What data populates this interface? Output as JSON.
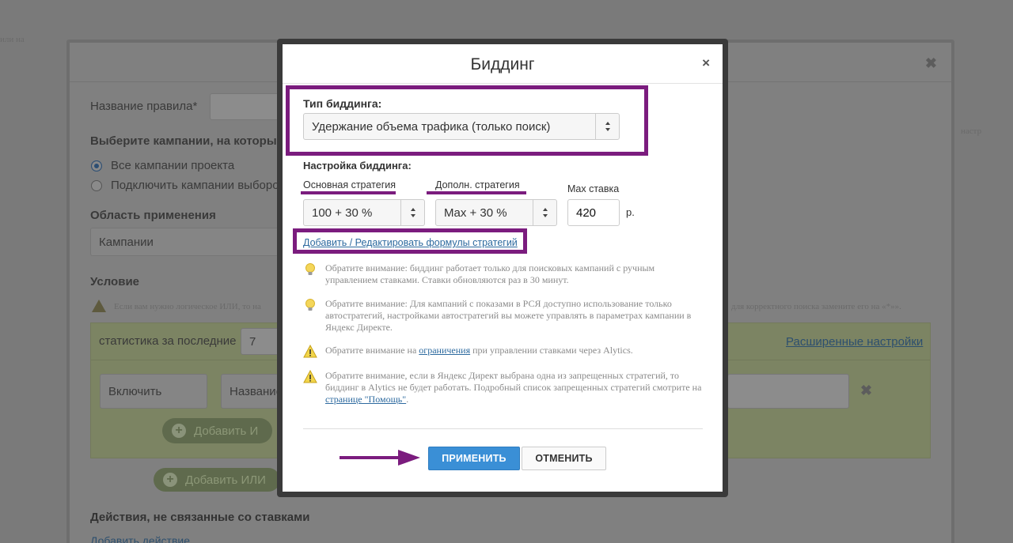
{
  "background": {
    "name_label": "Название правила*",
    "campaigns_heading": "Выберите кампании, на которые",
    "radio_all": "Все кампании проекта",
    "radio_select": "Подключить кампании выборочно",
    "scope_heading": "Область применения",
    "scope_value": "Кампании",
    "condition_heading": "Условие",
    "condition_hint_left": "Если вам нужно логическое ИЛИ, то на",
    "condition_hint_right": "для корректного поиска замените его на «*»».",
    "stats_label": "статистика за последние",
    "stats_value": "7",
    "advanced_link": "Расширенные настройки",
    "include_value": "Включить",
    "name_value": "Название",
    "add_and": "Добавить И",
    "add_or": "Добавить ИЛИ",
    "actions_heading": "Действия, не связанные со ставками",
    "add_action": "Добавить действие",
    "top_left_frag": "или на",
    "right_frag": "настр"
  },
  "dialog": {
    "title": "Биддинг",
    "close_label": "×",
    "bidding_type_label": "Тип биддинга:",
    "bidding_type_value": "Удержание объема трафика (только поиск)",
    "settings_label": "Настройка биддинга:",
    "main_strategy_label": "Основная стратегия",
    "main_strategy_value": "100 + 30 %",
    "extra_strategy_label": "Дополн. стратегия",
    "extra_strategy_value": "Max + 30 %",
    "max_bid_label": "Max ставка",
    "max_bid_value": "420",
    "currency": "р.",
    "formulas_link": "Добавить / Редактировать формулы стратегий",
    "note1": "Обратите внимание: биддинг работает только для поисковых кампаний с ручным управлением ставками. Ставки обновляются раз в 30 минут.",
    "note2": "Обратите внимание: Для кампаний с показами в РСЯ доступно использование только автостратегий, настройками автостратегий вы можете управлять в параметрах кампании в Яндекс Директе.",
    "note3_before": "Обратите внимание на ",
    "note3_link": "ограничения",
    "note3_after": " при управлении ставками через Alytics.",
    "note4_before": "Обратите внимание, если в Яндекс Директ выбрана одна из запрещенных стратегий, то биддинг в Alytics не будет работать. Подробный список запрещенных стратегий смотрите на ",
    "note4_link": "странице \"Помощь\"",
    "note4_after": ".",
    "apply_label": "ПРИМЕНИТЬ",
    "cancel_label": "ОТМЕНИТЬ"
  },
  "colors": {
    "annotation": "#7b1c7e",
    "primary": "#3a8fd6",
    "link": "#2d6a9f",
    "overlay": "#7a7a7a"
  },
  "icons": [
    "lightbulb-icon",
    "warning-icon",
    "close-icon",
    "select-arrows-icon",
    "arrow-right-icon"
  ]
}
